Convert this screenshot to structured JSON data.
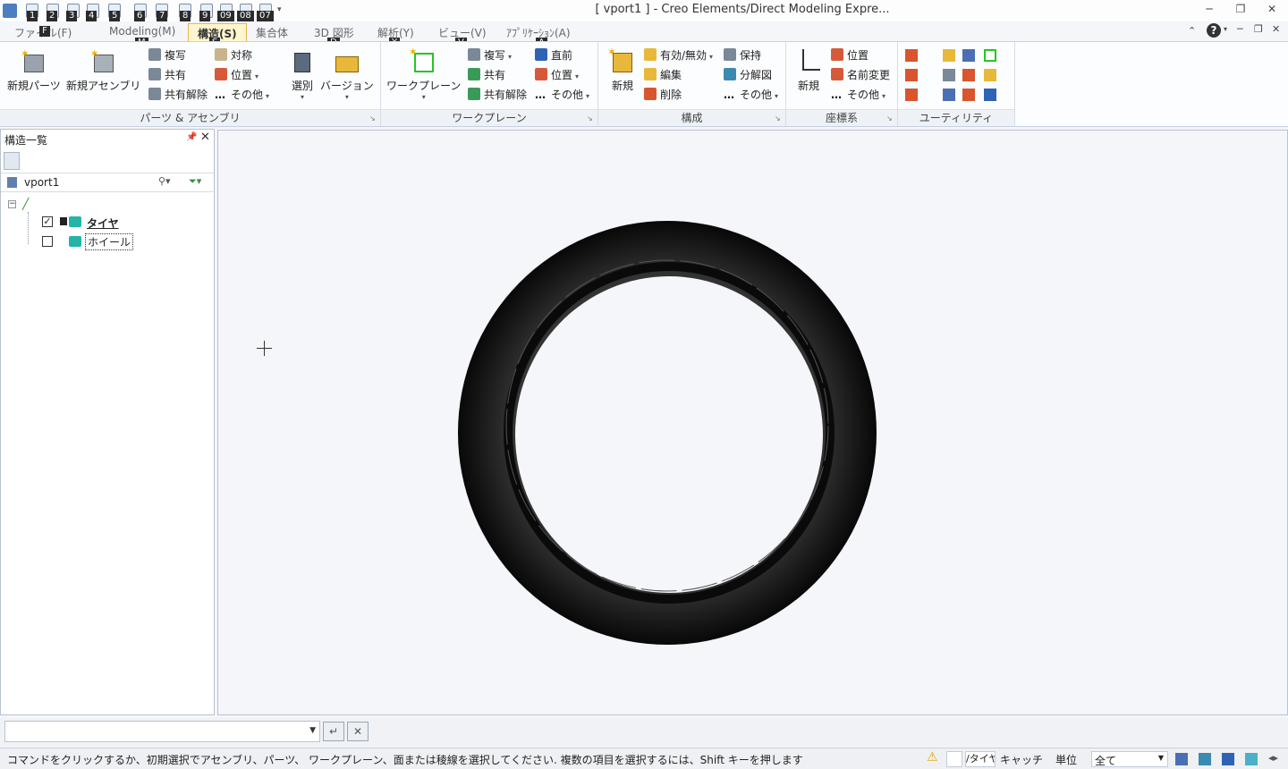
{
  "window": {
    "title": "[ vport1 ] - Creo Elements/Direct Modeling Expre...",
    "minimize_icon": "minimize-icon",
    "restore_icon": "restore-icon",
    "close_icon": "close-icon"
  },
  "qat_keytips": [
    "1",
    "2",
    "3",
    "4",
    "5",
    "6",
    "7",
    "8",
    "9",
    "09",
    "08",
    "07"
  ],
  "tabs": [
    {
      "label": "ファイル(F)",
      "keytip": "F"
    },
    {
      "label": "Modeling(M)",
      "keytip": "M"
    },
    {
      "label": "構造(S)",
      "keytip": "S"
    },
    {
      "label": "集合体",
      "keytip": "D"
    },
    {
      "label": "3D 図形",
      "keytip": "Y"
    },
    {
      "label": "解析(Y)",
      "keytip": "V"
    },
    {
      "label": "ビュー(V)",
      "keytip": "A"
    },
    {
      "label": "ｱﾌﾟﾘｹｰｼｮﾝ(A)",
      "keytip": ""
    }
  ],
  "ribbon": {
    "groups": {
      "parts": {
        "label": "パーツ & アセンブリ",
        "new_part": "新規パーツ",
        "new_assembly": "新規アセンブリ",
        "copy": "複写",
        "share": "共有",
        "unshare": "共有解除",
        "mirror": "対称",
        "position": "位置",
        "other": "その他",
        "select": "選別",
        "version": "バージョン"
      },
      "workplane": {
        "label": "ワークプレーン",
        "workplane": "ワークプレーン",
        "copy": "複写",
        "share": "共有",
        "unshare": "共有解除",
        "front": "直前",
        "position": "位置",
        "other": "その他"
      },
      "config": {
        "label": "構成",
        "new": "新規",
        "enable": "有効/無効",
        "edit": "編集",
        "delete": "削除",
        "keep": "保持",
        "explode": "分解図",
        "other": "その他"
      },
      "coord": {
        "label": "座標系",
        "new": "新規",
        "position": "位置",
        "rename": "名前変更",
        "other": "その他"
      },
      "utility": {
        "label": "ユーティリティ"
      }
    }
  },
  "panel": {
    "title": "構造一覧",
    "root": "vport1",
    "items": [
      {
        "label": "タイヤ",
        "checked": true
      },
      {
        "label": "ホイール",
        "checked": false
      }
    ]
  },
  "status": {
    "message": "コマンドをクリックするか、初期選択でアセンブリ、パーツ、 ワークプレーン、面または稜線を選択してください. 複数の項目を選択するには、Shift キーを押します",
    "current": "/タイヤ",
    "snap": "キャッチ",
    "unit": "単位",
    "filter": "全て"
  },
  "colors": {
    "accent": "#e6b64c",
    "tire": "#1c1c1c",
    "canvas": "#f4f6fa"
  }
}
